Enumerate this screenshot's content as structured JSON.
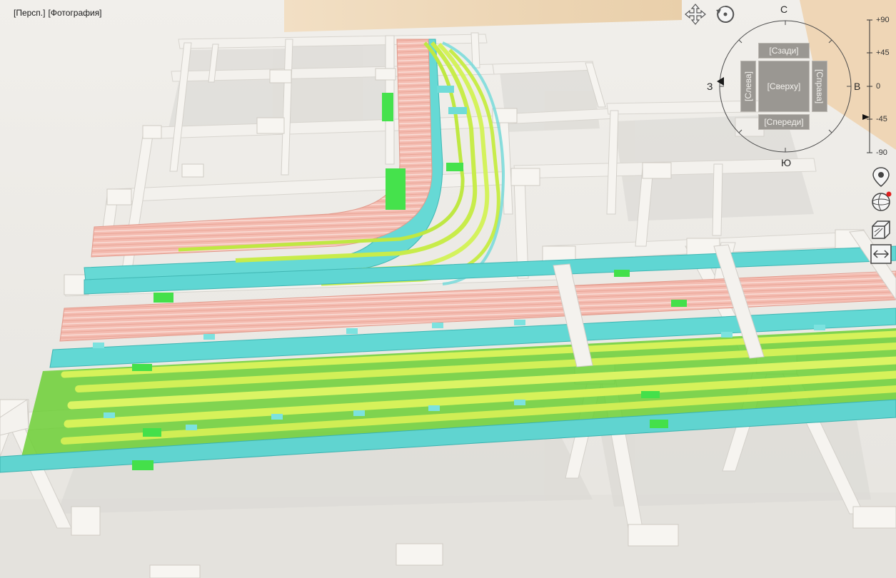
{
  "viewport": {
    "label_projection": "[Персп.]",
    "label_style": "[Фотография]"
  },
  "viewcube": {
    "top": "[Сверху]",
    "back": "[Сзади]",
    "front": "[Спереди]",
    "left": "[Слева]",
    "right": "[Справа]",
    "north": "С",
    "south": "Ю",
    "west": "З",
    "east": "В"
  },
  "tilt_scale": {
    "p90": "+90",
    "p45": "+45",
    "zero": "0",
    "m45": "-45",
    "m90": "-90"
  },
  "tools": {
    "pan_icon": "move-arrows-icon",
    "orbit_icon": "orbit-rotate-icon",
    "location_icon": "location-pin-icon",
    "globe_icon": "globe-icon",
    "section_icon": "section-box-icon",
    "measure_icon": "measure-arrows-icon"
  },
  "colors": {
    "cable_pink": "#f4b9ad",
    "tray_cyan": "#5fd6d3",
    "pipe_yellow": "#d8f25a",
    "support_green": "#44e04a",
    "frame_white": "#f2f0ec"
  }
}
